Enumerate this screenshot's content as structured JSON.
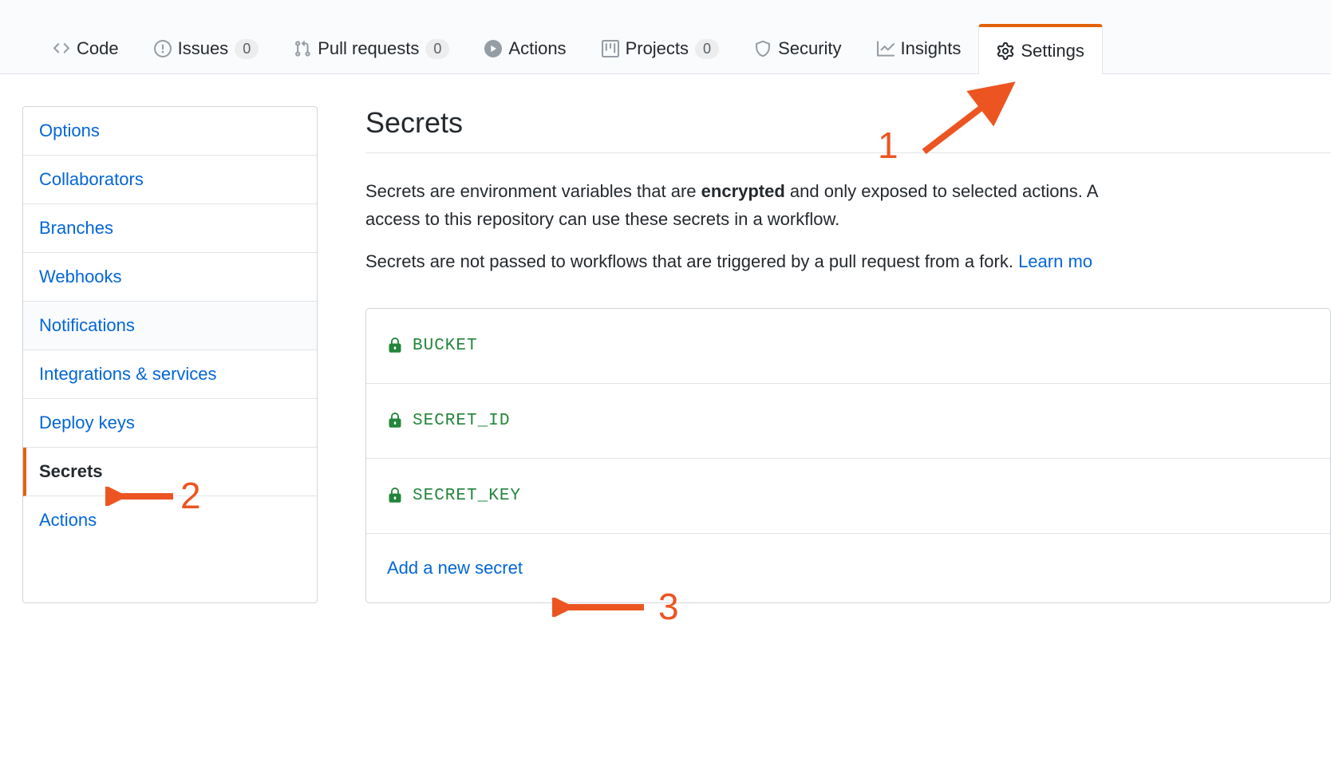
{
  "topnav": {
    "items": [
      {
        "label": "Code",
        "count": null
      },
      {
        "label": "Issues",
        "count": "0"
      },
      {
        "label": "Pull requests",
        "count": "0"
      },
      {
        "label": "Actions",
        "count": null
      },
      {
        "label": "Projects",
        "count": "0"
      },
      {
        "label": "Security",
        "count": null
      },
      {
        "label": "Insights",
        "count": null
      },
      {
        "label": "Settings",
        "count": null
      }
    ]
  },
  "sidebar": {
    "items": [
      {
        "label": "Options"
      },
      {
        "label": "Collaborators"
      },
      {
        "label": "Branches"
      },
      {
        "label": "Webhooks"
      },
      {
        "label": "Notifications"
      },
      {
        "label": "Integrations & services"
      },
      {
        "label": "Deploy keys"
      },
      {
        "label": "Secrets"
      },
      {
        "label": "Actions"
      }
    ]
  },
  "main": {
    "title": "Secrets",
    "desc1_pre": "Secrets are environment variables that are ",
    "desc1_strong": "encrypted",
    "desc1_post": " and only exposed to selected actions. A",
    "desc1_line2": "access to this repository can use these secrets in a workflow.",
    "desc2": "Secrets are not passed to workflows that are triggered by a pull request from a fork. ",
    "learn_more": "Learn mo",
    "secrets": [
      {
        "name": "BUCKET"
      },
      {
        "name": "SECRET_ID"
      },
      {
        "name": "SECRET_KEY"
      }
    ],
    "add_label": "Add a new secret"
  },
  "annotations": {
    "n1": "1",
    "n2": "2",
    "n3": "3"
  }
}
